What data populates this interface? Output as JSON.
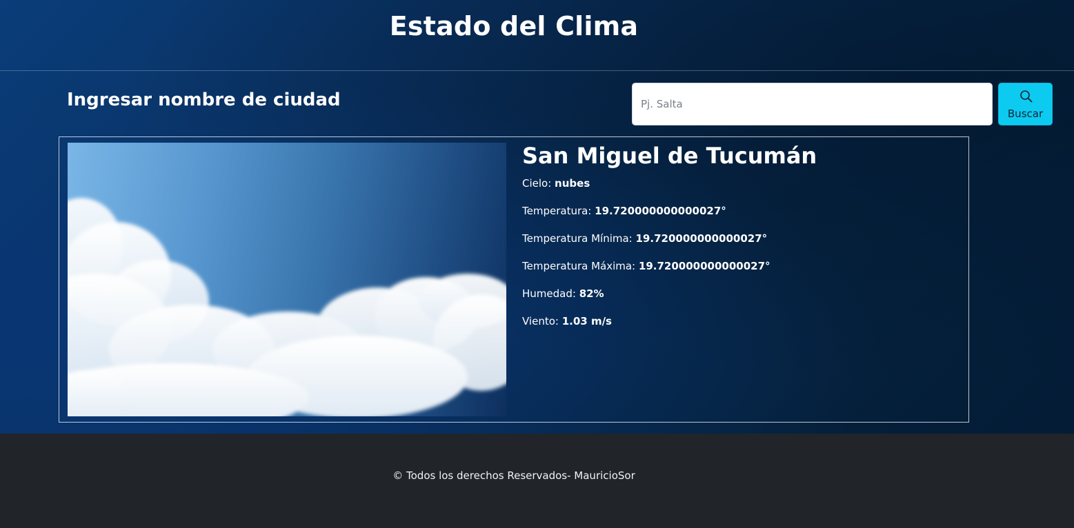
{
  "header": {
    "title": "Estado del Clima"
  },
  "search": {
    "label": "Ingresar nombre de ciudad",
    "placeholder": "Pj. Salta",
    "value": "",
    "button_label": "Buscar",
    "button_icon": "search-icon"
  },
  "weather": {
    "image_alt": "cloudy-sky-image",
    "city": "San Miguel de Tucumán",
    "details": [
      {
        "label": "Cielo:",
        "value": "nubes"
      },
      {
        "label": "Temperatura:",
        "value": "19.720000000000027°"
      },
      {
        "label": "Temperatura Mínima:",
        "value": "19.720000000000027°"
      },
      {
        "label": "Temperatura Máxima:",
        "value": "19.720000000000027°"
      },
      {
        "label": "Humedad:",
        "value": "82%"
      },
      {
        "label": "Viento:",
        "value": "1.03 m/s"
      }
    ]
  },
  "footer": {
    "text": "© Todos los derechos Reservados- MauricioSor"
  },
  "colors": {
    "button_accent": "#0dcaf0",
    "footer_bg": "#212529",
    "page_bg_dark": "#062340"
  }
}
